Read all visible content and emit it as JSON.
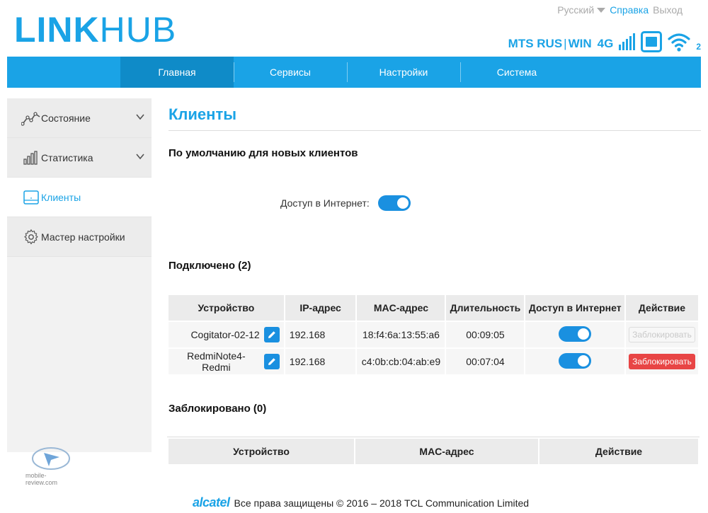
{
  "header": {
    "logo_part1": "LINK",
    "logo_part2": "HUB",
    "language": "Русский",
    "help": "Справка",
    "logout": "Выход",
    "operator": "MTS RUS",
    "operator_sep": "|",
    "operator2": "WIN",
    "network": "4G",
    "wifi_clients": "2"
  },
  "nav": {
    "tabs": [
      {
        "label": "Главная",
        "active": true
      },
      {
        "label": "Сервисы"
      },
      {
        "label": "Настройки"
      },
      {
        "label": "Система"
      }
    ]
  },
  "sidebar": {
    "items": [
      {
        "label": "Состояние",
        "icon": "chart-line-icon"
      },
      {
        "label": "Статистика",
        "icon": "bar-chart-icon"
      },
      {
        "label": "Клиенты",
        "icon": "device-icon",
        "active": true
      },
      {
        "label": "Мастер настройки",
        "icon": "gear-icon"
      }
    ],
    "watermark": "mobile-review.com"
  },
  "main": {
    "title": "Клиенты",
    "default_section": "По умолчанию для новых клиентов",
    "internet_access_label": "Доступ в Интернет:",
    "connected_title": "Подключено (2)",
    "connected_headers": [
      "Устройство",
      "IP-адрес",
      "MAC-адрес",
      "Длительность",
      "Доступ в Интернет",
      "Действие"
    ],
    "connected_rows": [
      {
        "device": "Cogitator-02-12",
        "ip": "192.168",
        "mac": "18:f4:6a:13:55:a6",
        "duration": "00:09:05",
        "action": "Заблокировать",
        "action_enabled": false
      },
      {
        "device": "RedmiNote4-Redmi",
        "ip": "192.168",
        "mac": "c4:0b:cb:04:ab:e9",
        "duration": "00:07:04",
        "action": "Заблокировать",
        "action_enabled": true
      }
    ],
    "blocked_title": "Заблокировано (0)",
    "blocked_headers": [
      "Устройство",
      "MAC-адрес",
      "Действие"
    ]
  },
  "footer": {
    "brand": "alcatel",
    "copyright": "Все права защищены © 2016 – 2018 TCL Communication Limited"
  },
  "colors": {
    "accent": "#1aa3e6",
    "nav_active": "#0f8bc8",
    "toggle": "#1a90e0",
    "danger": "#e84545"
  }
}
